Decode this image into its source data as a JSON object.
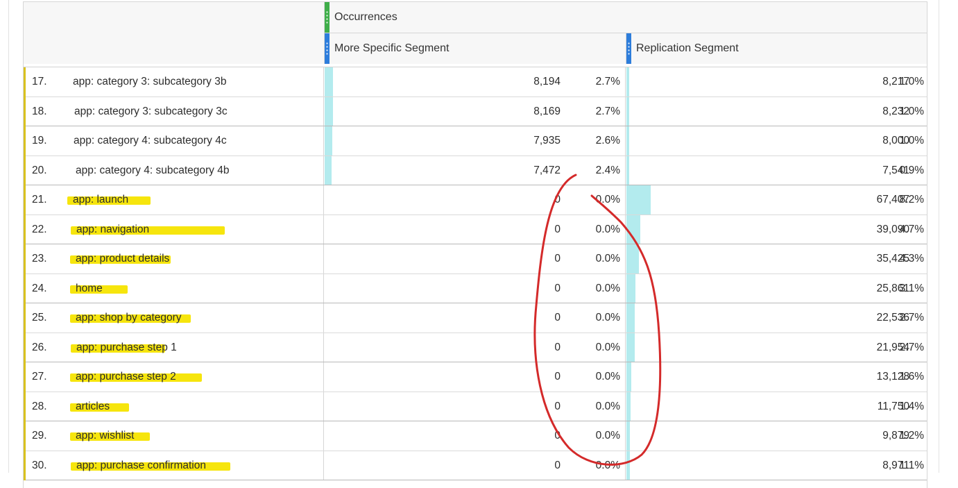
{
  "header": {
    "metric_title": "Occurrences",
    "segment_1": "More Specific Segment",
    "segment_2": "Replication Segment"
  },
  "rows": [
    {
      "num": "17.",
      "label": "app: category 3: subcategory 3b",
      "s1_value": "8,194",
      "s1_pct": "2.7%",
      "s1_bar": 0.027,
      "s2_value": "8,217",
      "s2_pct": "1.0%",
      "s2_bar": 0.01,
      "highlight": false
    },
    {
      "num": "18.",
      "label": "app: category 3: subcategory 3c",
      "s1_value": "8,169",
      "s1_pct": "2.7%",
      "s1_bar": 0.027,
      "s2_value": "8,232",
      "s2_pct": "1.0%",
      "s2_bar": 0.01,
      "highlight": false
    },
    {
      "num": "19.",
      "label": "app: category 4: subcategory 4c",
      "s1_value": "7,935",
      "s1_pct": "2.6%",
      "s1_bar": 0.026,
      "s2_value": "8,000",
      "s2_pct": "1.0%",
      "s2_bar": 0.01,
      "highlight": false
    },
    {
      "num": "20.",
      "label": "app: category 4: subcategory 4b",
      "s1_value": "7,472",
      "s1_pct": "2.4%",
      "s1_bar": 0.024,
      "s2_value": "7,541",
      "s2_pct": "0.9%",
      "s2_bar": 0.009,
      "highlight": false
    },
    {
      "num": "21.",
      "label": "app: launch",
      "s1_value": "0",
      "s1_pct": "0.0%",
      "s1_bar": 0,
      "s2_value": "67,407",
      "s2_pct": "8.2%",
      "s2_bar": 0.082,
      "highlight": true
    },
    {
      "num": "22.",
      "label": "app: navigation",
      "s1_value": "0",
      "s1_pct": "0.0%",
      "s1_bar": 0,
      "s2_value": "39,090",
      "s2_pct": "4.7%",
      "s2_bar": 0.047,
      "highlight": true
    },
    {
      "num": "23.",
      "label": "app: product details",
      "s1_value": "0",
      "s1_pct": "0.0%",
      "s1_bar": 0,
      "s2_value": "35,425",
      "s2_pct": "4.3%",
      "s2_bar": 0.043,
      "highlight": true
    },
    {
      "num": "24.",
      "label": "home",
      "s1_value": "0",
      "s1_pct": "0.0%",
      "s1_bar": 0,
      "s2_value": "25,861",
      "s2_pct": "3.1%",
      "s2_bar": 0.031,
      "highlight": true
    },
    {
      "num": "25.",
      "label": "app: shop by category",
      "s1_value": "0",
      "s1_pct": "0.0%",
      "s1_bar": 0,
      "s2_value": "22,536",
      "s2_pct": "2.7%",
      "s2_bar": 0.027,
      "highlight": true
    },
    {
      "num": "26.",
      "label": "app: purchase step 1",
      "s1_value": "0",
      "s1_pct": "0.0%",
      "s1_bar": 0,
      "s2_value": "21,954",
      "s2_pct": "2.7%",
      "s2_bar": 0.027,
      "highlight": true
    },
    {
      "num": "27.",
      "label": "app: purchase step 2",
      "s1_value": "0",
      "s1_pct": "0.0%",
      "s1_bar": 0,
      "s2_value": "13,128",
      "s2_pct": "1.6%",
      "s2_bar": 0.016,
      "highlight": true
    },
    {
      "num": "28.",
      "label": "articles",
      "s1_value": "0",
      "s1_pct": "0.0%",
      "s1_bar": 0,
      "s2_value": "11,750",
      "s2_pct": "1.4%",
      "s2_bar": 0.014,
      "highlight": true
    },
    {
      "num": "29.",
      "label": "app: wishlist",
      "s1_value": "0",
      "s1_pct": "0.0%",
      "s1_bar": 0,
      "s2_value": "9,879",
      "s2_pct": "1.2%",
      "s2_bar": 0.012,
      "highlight": true
    },
    {
      "num": "30.",
      "label": "app: purchase confirmation",
      "s1_value": "0",
      "s1_pct": "0.0%",
      "s1_bar": 0,
      "s2_value": "8,971",
      "s2_pct": "1.1%",
      "s2_bar": 0.011,
      "highlight": true
    }
  ],
  "colors": {
    "bar_fill": "#b3ebee",
    "highlight": "#f6e400",
    "row_accent": "#d9c21e",
    "metric_grip": "#3fae4a",
    "segment_grip": "#2d7ddb",
    "annotation_circle": "#d42a2a"
  }
}
